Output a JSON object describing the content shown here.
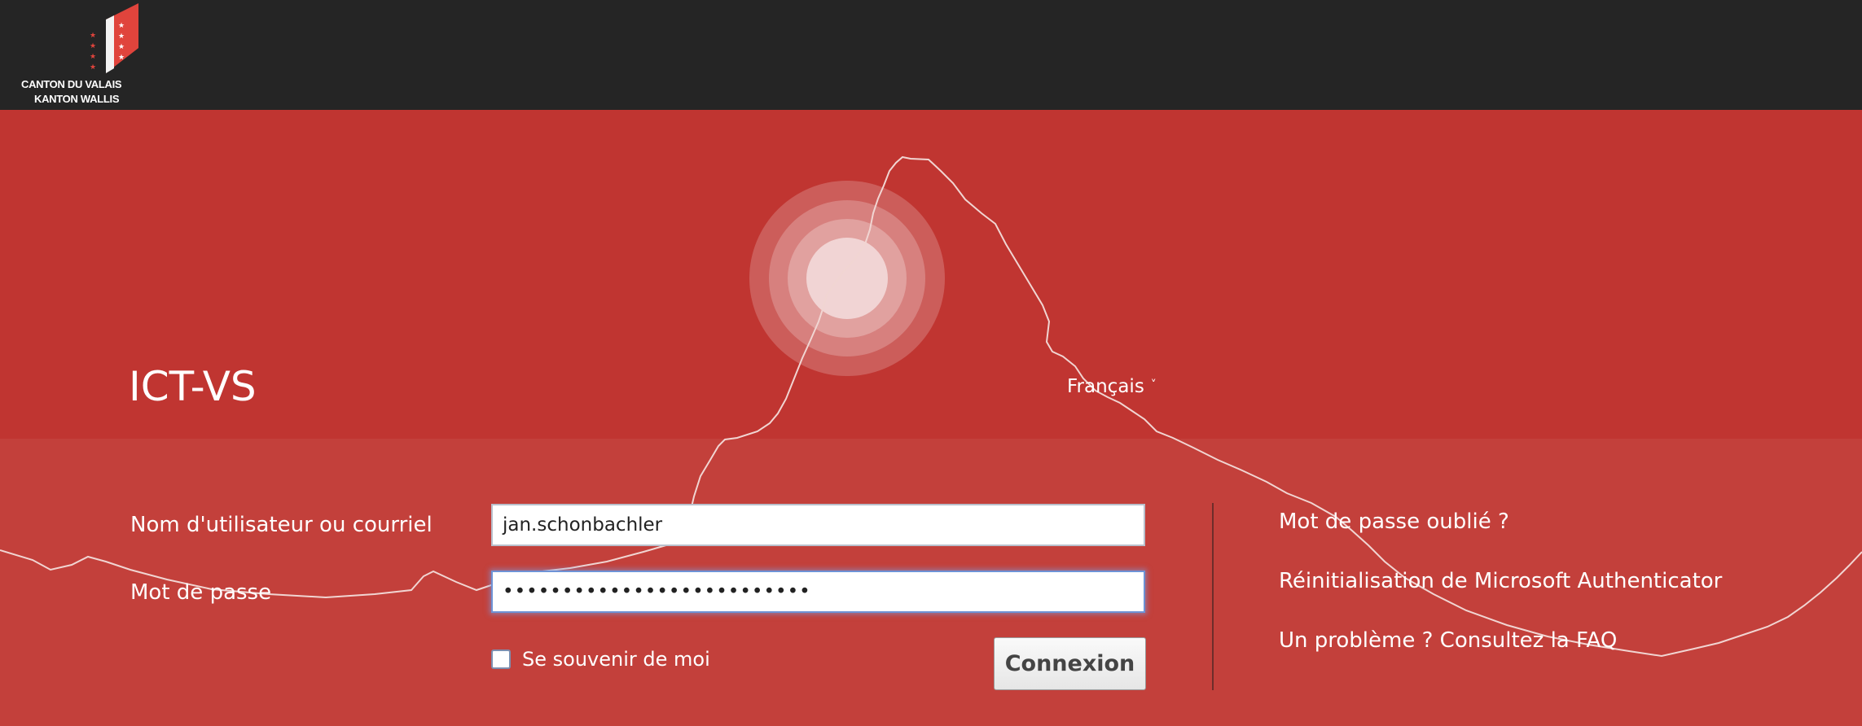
{
  "header": {
    "logo_line1": "CANTON DU VALAIS",
    "logo_line2": "KANTON WALLIS"
  },
  "app": {
    "title": "ICT-VS"
  },
  "language": {
    "selected": "Français",
    "chevron": "˅"
  },
  "form": {
    "username_label": "Nom d'utilisateur ou courriel",
    "username_value": "jan.schonbachler",
    "password_label": "Mot de passe",
    "password_value": "••••••••••••••••••••••••••",
    "remember_label": "Se souvenir de moi",
    "submit_label": "Connexion"
  },
  "links": {
    "forgot_password": "Mot de passe oublié ?",
    "reset_authenticator": "Réinitialisation de Microsoft Authenticator",
    "faq": "Un problème ? Consultez la FAQ"
  },
  "colors": {
    "topbar": "#252525",
    "hero_red": "#c03531",
    "panel_red": "#c3403b",
    "text": "#ffffff",
    "logo_red": "#e0443c"
  }
}
